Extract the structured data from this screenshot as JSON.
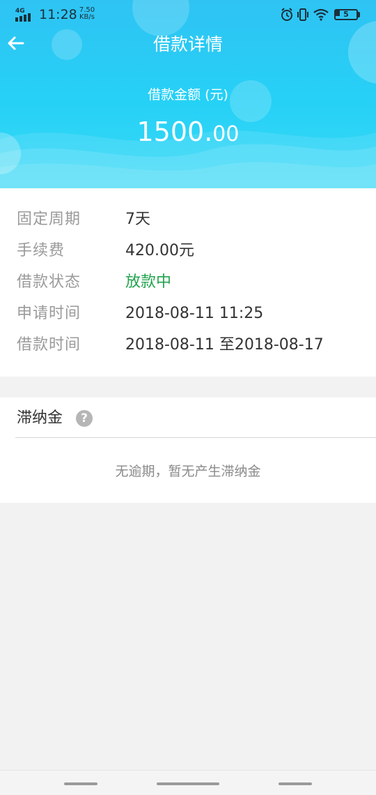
{
  "status_bar": {
    "network": "4G",
    "time": "11:28",
    "speed_value": "7.50",
    "speed_unit": "KB/s",
    "battery_level": "5"
  },
  "header": {
    "title": "借款详情",
    "amount_label": "借款金额 (元)",
    "amount_integer": "1500.",
    "amount_decimal": "00",
    "back_icon": "arrow-left-icon"
  },
  "details": {
    "rows": [
      {
        "label": "固定周期",
        "value": "7天"
      },
      {
        "label": "手续费",
        "value": "420.00元"
      },
      {
        "label": "借款状态",
        "value": "放款中"
      },
      {
        "label": "申请时间",
        "value": "2018-08-11 11:25"
      },
      {
        "label": "借款时间",
        "value": "2018-08-11 至2018-08-17"
      }
    ]
  },
  "late_fee": {
    "title": "滞纳金",
    "help_icon_glyph": "?",
    "empty_text": "无逾期，暂无产生滞纳金"
  },
  "colors": {
    "header_start": "#2fc3f3",
    "header_end": "#3ad9f6",
    "status_green": "#21a34d",
    "label_gray": "#9a9a9a",
    "value_dark": "#333333",
    "page_bg": "#f2f2f2"
  }
}
